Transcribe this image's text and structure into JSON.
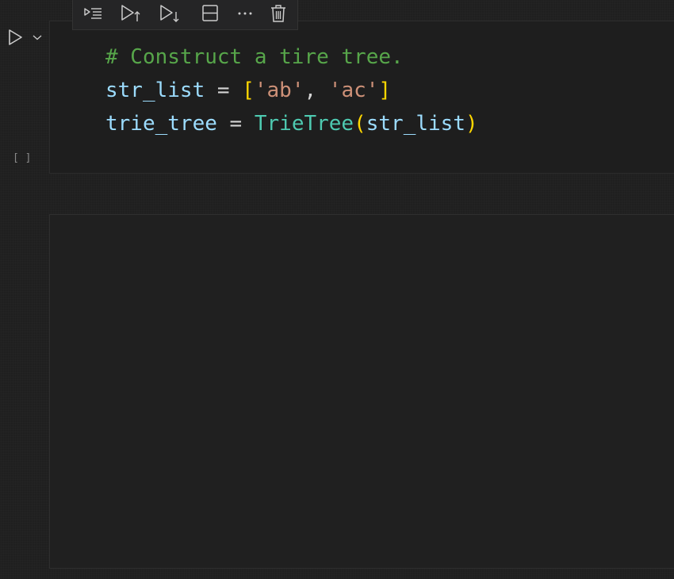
{
  "toolbar": {
    "buttons": [
      {
        "name": "run-above-button",
        "icon": "run-above-icon"
      },
      {
        "name": "run-cell-and-above-button",
        "icon": "run-up-icon"
      },
      {
        "name": "run-cell-and-below-button",
        "icon": "run-down-icon"
      },
      {
        "name": "split-cell-button",
        "icon": "split-cell-icon"
      },
      {
        "name": "more-actions-button",
        "icon": "ellipsis-icon"
      },
      {
        "name": "delete-cell-button",
        "icon": "trash-icon"
      }
    ],
    "more_glyph": "···"
  },
  "cell": {
    "run_icon": "play-icon",
    "dropdown_icon": "chevron-down-icon",
    "execution_count": "[ ]",
    "code": {
      "line1": {
        "comment": "# Construct a tire tree."
      },
      "line2": {
        "var": "str_list",
        "eq": " = ",
        "open": "[",
        "s1": "'ab'",
        "comma": ", ",
        "s2": "'ac'",
        "close": "]"
      },
      "line3": {
        "var": "trie_tree",
        "eq": " = ",
        "cls": "TrieTree",
        "open": "(",
        "arg": "str_list",
        "close": ")"
      }
    }
  },
  "colors": {
    "background": "#1f1f1f",
    "comment": "#57a64a",
    "variable": "#9cdcfe",
    "string": "#ce9178",
    "bracket": "#ffd700",
    "class": "#4ec9b0"
  }
}
